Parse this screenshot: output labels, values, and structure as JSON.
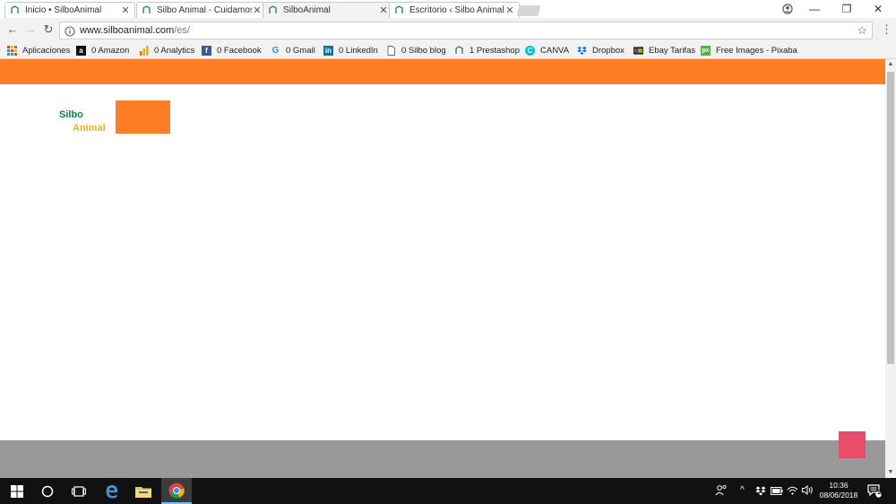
{
  "tabs": [
    {
      "label": "Inicio • SilboAnimal",
      "close": "✕",
      "active": false
    },
    {
      "label": "Silbo Animal - Cuidamos",
      "close": "✕",
      "active": false
    },
    {
      "label": "SilboAnimal",
      "close": "✕",
      "active": true
    },
    {
      "label": "Escritorio ‹ Silbo Animal —",
      "close": "✕",
      "active": false
    }
  ],
  "window_controls": {
    "minimize": "—",
    "maximize": "❐",
    "close": "✕"
  },
  "toolbar": {
    "back": "←",
    "forward": "→",
    "reload": "↻",
    "url_host": "www.silboanimal.com",
    "url_path": "/es/",
    "star": "☆",
    "menu": "⋮"
  },
  "bookmarks": [
    {
      "label": "Aplicaciones",
      "icon": "apps-grid-icon",
      "color": "#e94235"
    },
    {
      "label": "0 Amazon",
      "icon": "amazon-icon",
      "color": "#111111"
    },
    {
      "label": "0 Analytics",
      "icon": "analytics-icon",
      "color": "#f9ab00"
    },
    {
      "label": "0 Facebook",
      "icon": "facebook-icon",
      "color": "#3b5998"
    },
    {
      "label": "0 Gmail",
      "icon": "google-icon",
      "color": "#ffffff"
    },
    {
      "label": "0 LinkedIn",
      "icon": "linkedin-icon",
      "color": "#0077b5"
    },
    {
      "label": "0 Silbo blog",
      "icon": "page-icon",
      "color": "#ffffff"
    },
    {
      "label": "1 Prestashop",
      "icon": "prestashop-icon",
      "color": "#ffffff"
    },
    {
      "label": "CANVA",
      "icon": "canva-icon",
      "color": "#00c4cc"
    },
    {
      "label": "Dropbox",
      "icon": "dropbox-icon",
      "color": "#0061fe"
    },
    {
      "label": "Ebay Tarifas",
      "icon": "ebay-icon",
      "color": "#ffffff"
    },
    {
      "label": "Free Images - Pixaba",
      "icon": "pixabay-icon",
      "color": "#4bb543"
    }
  ],
  "page": {
    "logo_line1": "Silbo",
    "logo_line2": "Animal",
    "colors": {
      "orange": "#fd7e25",
      "green": "#0f7f4f",
      "yellow": "#e1b718",
      "gray_footer": "#999999",
      "pink": "#ea4d69"
    }
  },
  "taskbar": {
    "clock_time": "10:36",
    "clock_date": "08/06/2018",
    "notifications_count": "2",
    "tray_chevron": "^"
  }
}
